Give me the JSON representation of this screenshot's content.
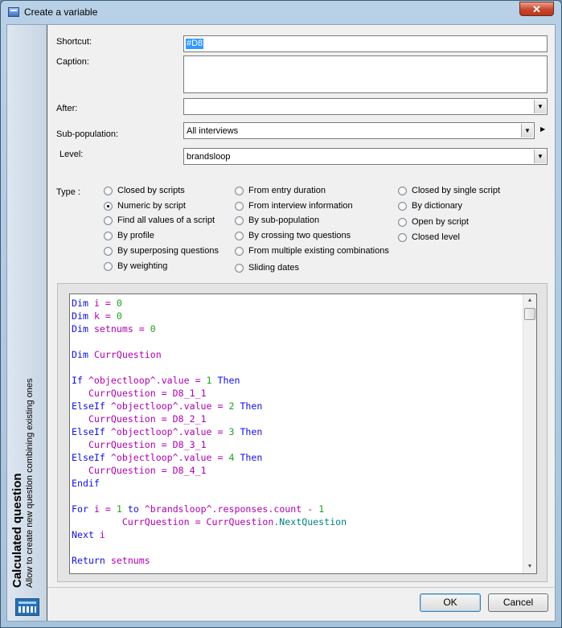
{
  "window": {
    "title": "Create a variable",
    "close_label": "✕",
    "icon": "app-form-icon"
  },
  "side_panel": {
    "title": "Calculated question",
    "subtitle": "Allow to create new question combining existing ones",
    "icon": "calculator-icon"
  },
  "form": {
    "shortcut": {
      "label": "Shortcut:",
      "value": "#D8"
    },
    "caption": {
      "label": "Caption:",
      "value": ""
    },
    "after": {
      "label": "After:",
      "value": ""
    },
    "subpopulation": {
      "label": "Sub-population:",
      "value": "All interviews"
    },
    "level": {
      "label": "Level:",
      "value": "brandsloop"
    }
  },
  "type": {
    "label": "Type :",
    "selected": "Numeric by script",
    "col1": [
      "Closed by scripts",
      "Numeric by script",
      "Find all values of a script",
      "By profile",
      "By superposing questions",
      "By weighting"
    ],
    "col2": [
      "From entry duration",
      "From interview information",
      "By sub-population",
      "By crossing two questions",
      "From multiple existing combinations",
      "Sliding dates"
    ],
    "col3": [
      "Closed by single script",
      "By dictionary",
      "Open by script",
      "Closed level"
    ]
  },
  "script": {
    "lines": [
      "Dim i = 0",
      "Dim k = 0",
      "Dim setnums = 0",
      "",
      "Dim CurrQuestion",
      "",
      "If ^objectloop^.value = 1 Then",
      "   CurrQuestion = D8_1_1",
      "ElseIf ^objectloop^.value = 2 Then",
      "   CurrQuestion = D8_2_1",
      "ElseIf ^objectloop^.value = 3 Then",
      "   CurrQuestion = D8_3_1",
      "ElseIf ^objectloop^.value = 4 Then",
      "   CurrQuestion = D8_4_1",
      "Endif",
      "",
      "For i = 1 to ^brandsloop^.responses.count - 1",
      "         CurrQuestion = CurrQuestion.NextQuestion",
      "Next i",
      "",
      "Return setnums"
    ]
  },
  "buttons": {
    "ok": "OK",
    "cancel": "Cancel"
  },
  "colors": {
    "keyword": "#1010e0",
    "identifier": "#b000b0",
    "number": "#20a020",
    "selection": "#3399ff"
  }
}
